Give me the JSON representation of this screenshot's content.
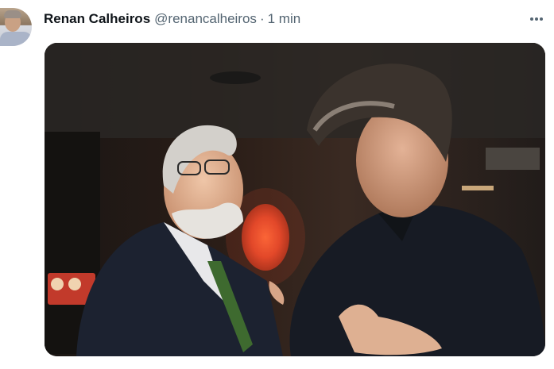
{
  "tweet": {
    "author_name": "Renan Calheiros",
    "handle": "@renancalheiros",
    "separator": "·",
    "timestamp": "1 min",
    "more_icon": "more-horizontal-icon",
    "avatar_icon": "user-avatar"
  },
  "colors": {
    "name": "#0f1419",
    "secondary": "#536471",
    "background": "#ffffff"
  }
}
